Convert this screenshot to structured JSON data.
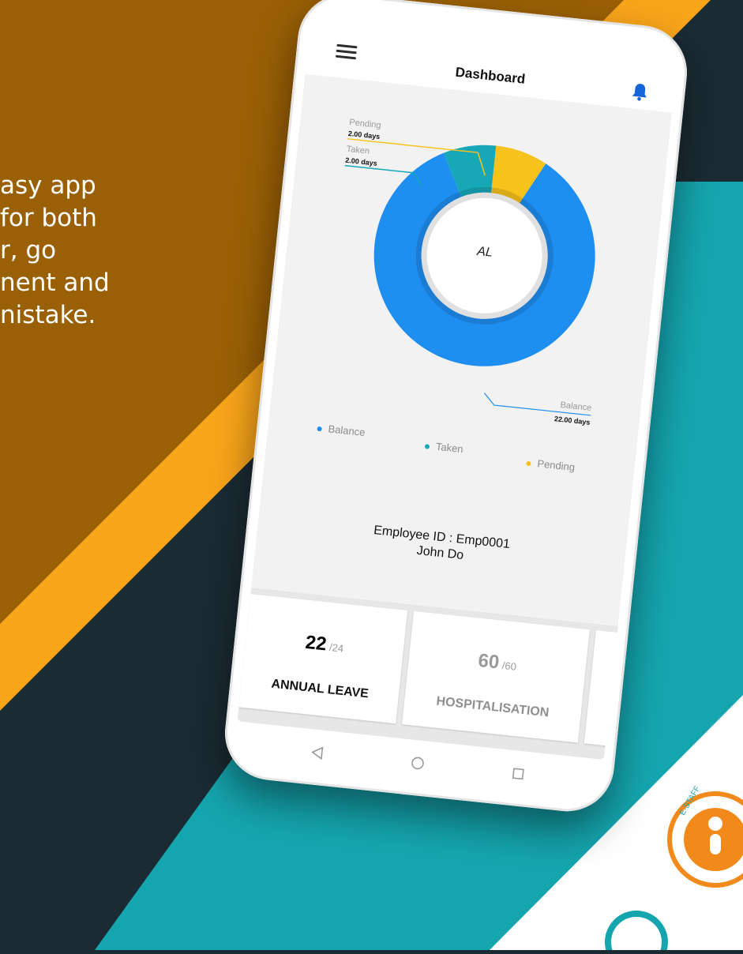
{
  "promo": {
    "lines": [
      "asy app",
      "for both",
      "r, go",
      "nent and",
      "nistake."
    ]
  },
  "header": {
    "title": "Dashboard",
    "menu_icon": "hamburger-menu-icon",
    "bell_icon": "bell-icon"
  },
  "chart_data": {
    "type": "pie",
    "center_label": "AL",
    "slices": [
      {
        "name": "Balance",
        "label": "Balance",
        "value": 22,
        "value_text": "22.00 days",
        "color": "#1e8ef0"
      },
      {
        "name": "Taken",
        "label": "Taken",
        "value": 2,
        "value_text": "2.00 days",
        "color": "#17a8b8"
      },
      {
        "name": "Pending",
        "label": "Pending",
        "value": 2,
        "value_text": "2.00 days",
        "color": "#f7c21c"
      }
    ]
  },
  "legend": [
    "Balance",
    "Taken",
    "Pending"
  ],
  "employee": {
    "id_line": "Employee ID : Emp0001",
    "name": "John Do"
  },
  "tiles": [
    {
      "value": "22",
      "total": "/24",
      "label": "ANNUAL LEAVE"
    },
    {
      "value": "60",
      "total": "/60",
      "label": "HOSPITALISATION"
    }
  ],
  "nav": {
    "back_icon": "back-icon",
    "home_icon": "home-icon",
    "recents_icon": "recents-icon"
  },
  "logo": {
    "text": "E-STAFF"
  },
  "colors": {
    "brown": "#9a6005",
    "orange": "#f9a51a",
    "dark": "#1b2b33",
    "teal": "#15a5ae",
    "balance": "#1e8ef0",
    "taken": "#17a8b8",
    "pending": "#f7c21c"
  }
}
